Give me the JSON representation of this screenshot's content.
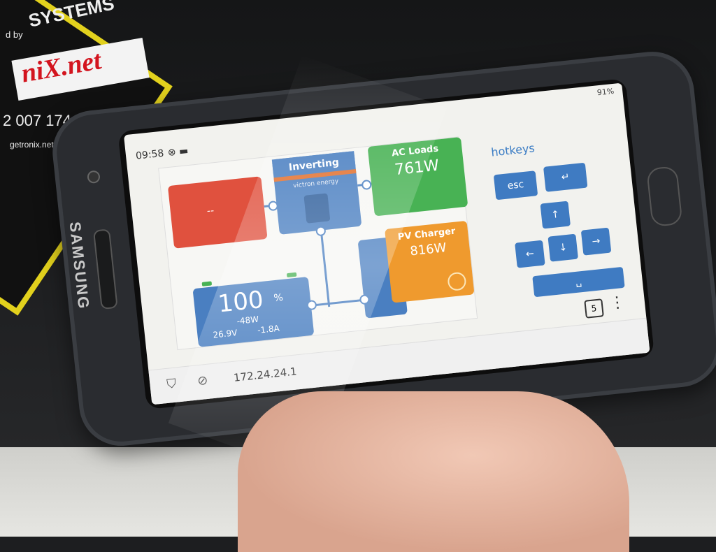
{
  "sticker": {
    "line1": "SYSTEMS",
    "line2": "d by",
    "brand": "niX.net",
    "phone": "2 007 174",
    "site": "getronix.net"
  },
  "phone": {
    "maker": "SAMSUNG",
    "system_status": "91%"
  },
  "app": {
    "time": "09:58",
    "status_icons": "⊗ ▬",
    "red_tile_value": "--",
    "inverter": {
      "title": "Inverting",
      "brand": "victron energy"
    },
    "ac_loads": {
      "label": "AC Loads",
      "value": "761W"
    },
    "pv_charger": {
      "label": "PV Charger",
      "value": "816W"
    },
    "battery": {
      "soc": "100",
      "soc_unit": "%",
      "power": "-48W",
      "voltage": "26.9V",
      "current": "-1.8A"
    },
    "hotkeys": {
      "title": "hotkeys",
      "esc": "esc",
      "enter": "↵",
      "up": "↑",
      "down": "↓",
      "left": "←",
      "right": "→",
      "space": "␣"
    }
  },
  "browser": {
    "url": "172.24.24.1",
    "tab_count": "5",
    "shield_icon": "shield",
    "tracking_icon": "tracking-protection"
  }
}
